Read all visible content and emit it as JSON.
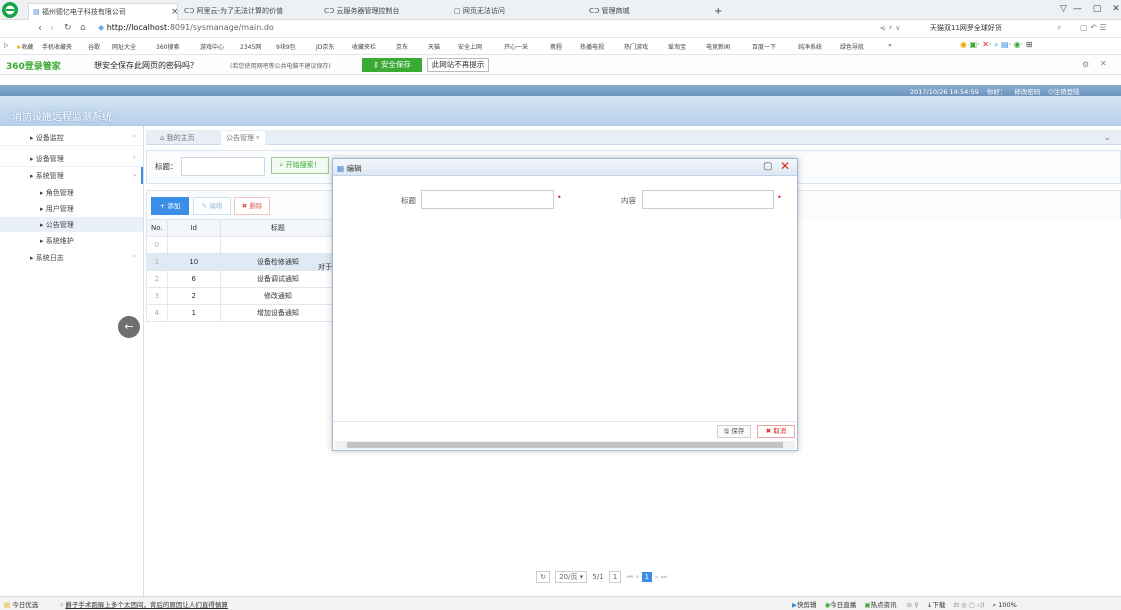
{
  "browser": {
    "tabs": [
      {
        "label": "福州德亿电子科技有限公司"
      },
      {
        "label": "阿里云-为了无法计算的价值"
      },
      {
        "label": "云服务器管理控制台"
      },
      {
        "label": "网页无法访问"
      },
      {
        "label": "管理商城"
      }
    ],
    "new_tab": "+",
    "window_controls": {
      "min": "—",
      "max": "▢",
      "close": "✕"
    },
    "url_host": "http://localhost",
    "url_path": ":8091/sysmanage/main.do",
    "search_text": "天猫双11网罗全球好货",
    "favorites": [
      "收藏",
      "手机收藏夹",
      "谷歌",
      "网址大全",
      "360搜索",
      "游戏中心",
      "2345网",
      "9块9包",
      "JD京东",
      "收藏夹栏",
      "京东",
      "天猫",
      "安全上网",
      "开心一采",
      "携程",
      "热播电视",
      "热门游戏",
      "爱淘宝",
      "电竞新闻",
      "百度一下",
      "纯净系统",
      "绿色导航"
    ],
    "fav_more": "»",
    "password_bar": {
      "brand": "360登录管家",
      "question": "想安全保存此网页的密码吗？",
      "hint": "(若您使用网吧等公共电脑不建议保存)",
      "save_btn": "安全保存",
      "never_btn": "此网站不再提示"
    }
  },
  "app": {
    "datetime": "2017/10/26 14:54:59",
    "greeting": "你好：",
    "change_pwd": "修改密码",
    "logout": "注销登陆",
    "title": "消防设施远程监测系统",
    "sidebar": [
      {
        "label": "设备监控"
      },
      {
        "label": "设备管理"
      },
      {
        "label": "系统管理"
      },
      {
        "label": "角色管理"
      },
      {
        "label": "用户管理"
      },
      {
        "label": "公告管理"
      },
      {
        "label": "系统维护"
      },
      {
        "label": "系统日志"
      }
    ],
    "breadcrumb": {
      "home": "我的主页",
      "current": "公告管理"
    },
    "search": {
      "label": "标题：",
      "button": "开始搜索！"
    },
    "toolbar": {
      "add": "添加",
      "edit": "编辑",
      "delete": "删除"
    },
    "table": {
      "headers": [
        "No.",
        "Id",
        "标题"
      ],
      "rows": [
        {
          "no": "0",
          "id": "",
          "title": ""
        },
        {
          "no": "1",
          "id": "10",
          "title": "设备检修通知"
        },
        {
          "no": "2",
          "id": "6",
          "title": "设备调试通知"
        },
        {
          "no": "3",
          "id": "2",
          "title": "修改通知"
        },
        {
          "no": "4",
          "id": "1",
          "title": "增加设备通知"
        }
      ],
      "extra_fragment": "对于"
    },
    "pager": {
      "page_size": "20/页",
      "pages": "5/1",
      "page_input": "1",
      "current_page": "1"
    },
    "dialog": {
      "title": "编辑",
      "field_title_label": "标题",
      "field_content_label": "内容",
      "required_mark": "•",
      "save": "保存",
      "cancel": "取消",
      "field_title_value": "",
      "field_content_value": ""
    }
  },
  "statusbar": {
    "left_label": "今日优选",
    "news": "爵子手术跑躲上多个太团间，背后的原因让人们直得慎算",
    "right_items": [
      "快剪辑",
      "今日直播",
      "热点资讯"
    ],
    "download": "下载",
    "zoom": "100%"
  },
  "colors": {
    "accent_blue": "#3a8ee6",
    "app_banner": "#c7dbef",
    "save_green": "#3aaa35",
    "danger_red": "#d9251d"
  }
}
